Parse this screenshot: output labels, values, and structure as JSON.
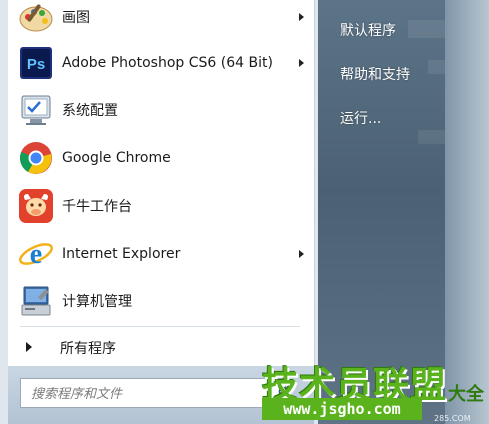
{
  "start_menu": {
    "programs": [
      {
        "label": "画图",
        "icon": "paint-icon",
        "has_submenu": true
      },
      {
        "label": "Adobe Photoshop CS6 (64 Bit)",
        "icon": "photoshop-icon",
        "icon_text": "Ps",
        "has_submenu": true
      },
      {
        "label": "系统配置",
        "icon": "system-config-icon",
        "has_submenu": false
      },
      {
        "label": "Google Chrome",
        "icon": "chrome-icon",
        "has_submenu": false
      },
      {
        "label": "千牛工作台",
        "icon": "qianniu-icon",
        "has_submenu": false
      },
      {
        "label": "Internet Explorer",
        "icon": "internet-explorer-icon",
        "has_submenu": true
      },
      {
        "label": "计算机管理",
        "icon": "computer-management-icon",
        "has_submenu": false
      }
    ],
    "all_programs_label": "所有程序",
    "search": {
      "placeholder": "搜索程序和文件",
      "value": ""
    },
    "right_items": [
      {
        "label": "默认程序"
      },
      {
        "label": "帮助和支持"
      },
      {
        "label": "运行..."
      }
    ]
  },
  "watermark": {
    "main": "技术员联盟",
    "url": "www.jsgho.com",
    "suffix": "大全",
    "sub": "285.COM"
  },
  "colors": {
    "accent_green": "#5ab31c",
    "glass_blue": "#4b6173",
    "ps_blue": "#1f2f7a",
    "chrome_red": "#db4437",
    "qianniu_red": "#e2412c",
    "ie_blue": "#1a7fd3"
  }
}
